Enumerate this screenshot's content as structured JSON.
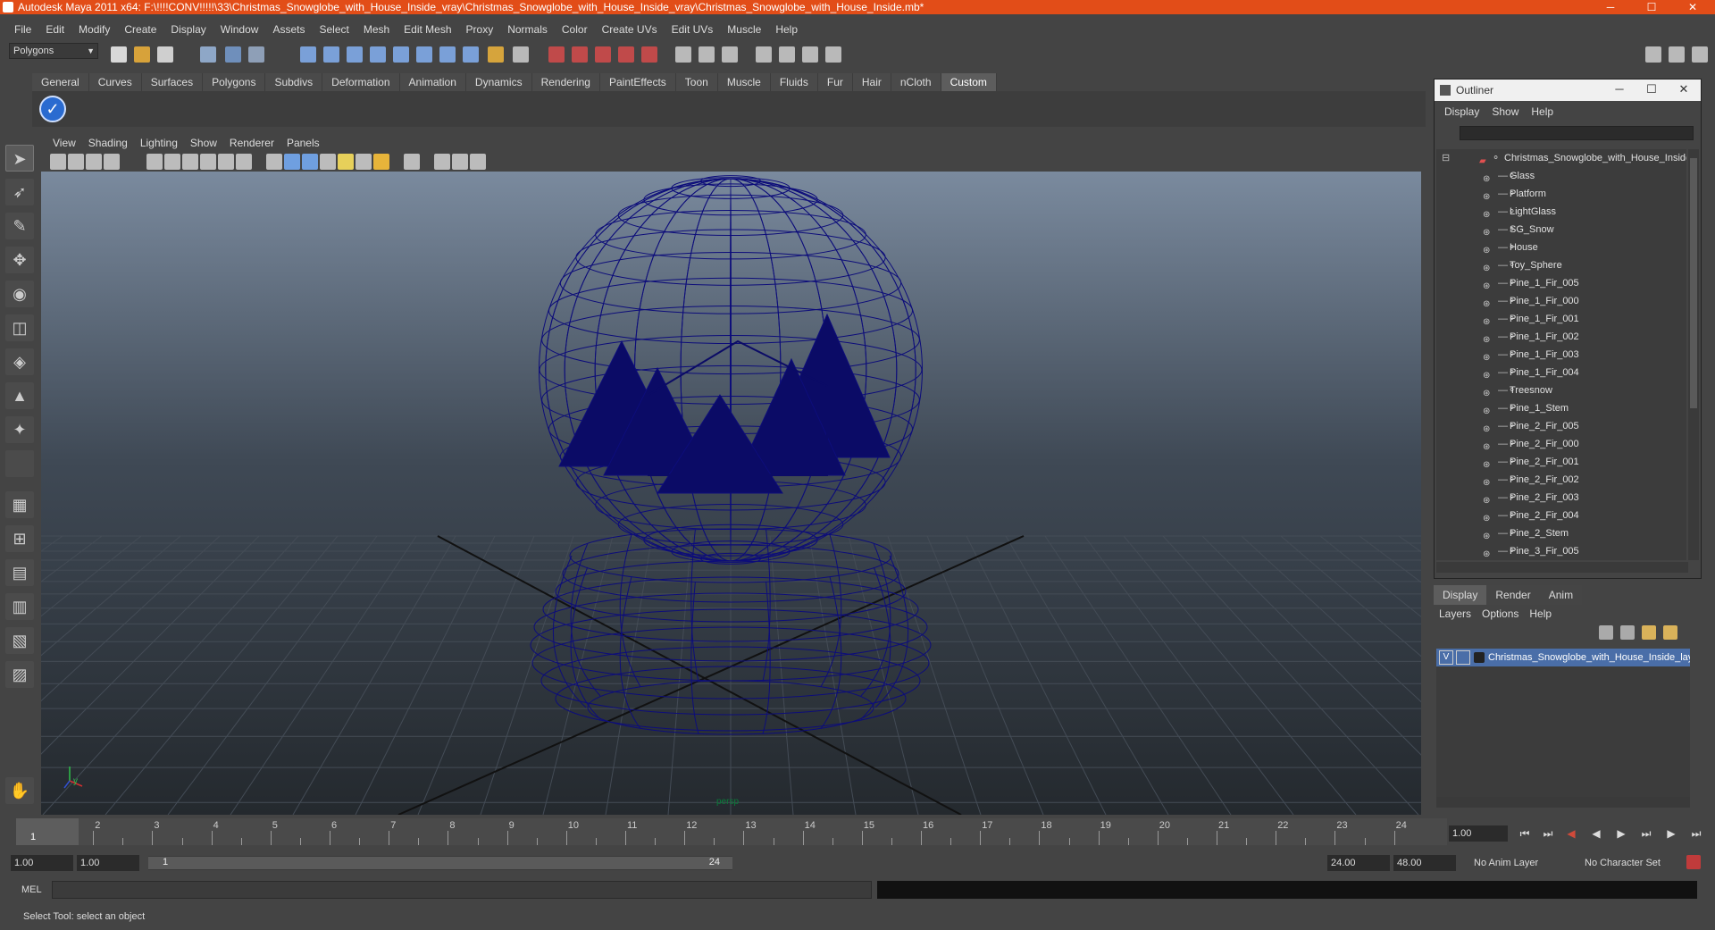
{
  "window": {
    "title": "Autodesk Maya 2011 x64: F:\\!!!!CONV!!!!!\\33\\Christmas_Snowglobe_with_House_Inside_vray\\Christmas_Snowglobe_with_House_Inside_vray\\Christmas_Snowglobe_with_House_Inside.mb*",
    "minimize": "─",
    "maximize": "☐",
    "close": "✕"
  },
  "menubar": [
    "File",
    "Edit",
    "Modify",
    "Create",
    "Display",
    "Window",
    "Assets",
    "Select",
    "Mesh",
    "Edit Mesh",
    "Proxy",
    "Normals",
    "Color",
    "Create UVs",
    "Edit UVs",
    "Muscle",
    "Help"
  ],
  "statusline": {
    "mode": "Polygons"
  },
  "shelf": {
    "tabs": [
      "General",
      "Curves",
      "Surfaces",
      "Polygons",
      "Subdivs",
      "Deformation",
      "Animation",
      "Dynamics",
      "Rendering",
      "PaintEffects",
      "Toon",
      "Muscle",
      "Fluids",
      "Fur",
      "Hair",
      "nCloth",
      "Custom"
    ],
    "active_tab": "Custom"
  },
  "viewport": {
    "menu": [
      "View",
      "Shading",
      "Lighting",
      "Show",
      "Renderer",
      "Panels"
    ],
    "camera_label": "persp",
    "axis_y": "y",
    "axis_x": "x"
  },
  "outliner": {
    "title": "Outliner",
    "menu": [
      "Display",
      "Show",
      "Help"
    ],
    "root": "Christmas_Snowglobe_with_House_Inside",
    "items": [
      "Glass",
      "Platform",
      "LightGlass",
      "SG_Snow",
      "House",
      "Toy_Sphere",
      "Pine_1_Fir_005",
      "Pine_1_Fir_000",
      "Pine_1_Fir_001",
      "Pine_1_Fir_002",
      "Pine_1_Fir_003",
      "Pine_1_Fir_004",
      "Treesnow",
      "Pine_1_Stem",
      "Pine_2_Fir_005",
      "Pine_2_Fir_000",
      "Pine_2_Fir_001",
      "Pine_2_Fir_002",
      "Pine_2_Fir_003",
      "Pine_2_Fir_004",
      "Pine_2_Stem",
      "Pine_3_Fir_005"
    ]
  },
  "layers": {
    "tabs": [
      "Display",
      "Render",
      "Anim"
    ],
    "active_tab": "Display",
    "menu": [
      "Layers",
      "Options",
      "Help"
    ],
    "layer_visible": "V",
    "layer_name": "Christmas_Snowglobe_with_House_Inside_layer"
  },
  "timeline": {
    "ticks": [
      "1",
      "2",
      "3",
      "4",
      "5",
      "6",
      "7",
      "8",
      "9",
      "10",
      "11",
      "12",
      "13",
      "14",
      "15",
      "16",
      "17",
      "18",
      "19",
      "20",
      "21",
      "22",
      "23",
      "24"
    ],
    "current_frame": "1",
    "current_frame_field": "1.00"
  },
  "playback": {
    "first": "⏮",
    "prev_key": "⏭",
    "prev_frame": "◀",
    "play": "▶",
    "next_frame": "▶",
    "next_key": "⏭",
    "last": "⏭"
  },
  "range": {
    "start": "1.00",
    "playback_start": "1.00",
    "slider_start": "1",
    "slider_end": "24",
    "playback_end": "24.00",
    "end": "48.00",
    "anim_layer": "No Anim Layer",
    "character_set": "No Character Set"
  },
  "command": {
    "label": "MEL"
  },
  "help": {
    "text": "Select Tool: select an object"
  },
  "colors": {
    "titlebar": "#e24d18",
    "wireframe": "#0d0d7a",
    "viewport_top": "#7a8a9e",
    "viewport_bottom": "#24292e"
  }
}
